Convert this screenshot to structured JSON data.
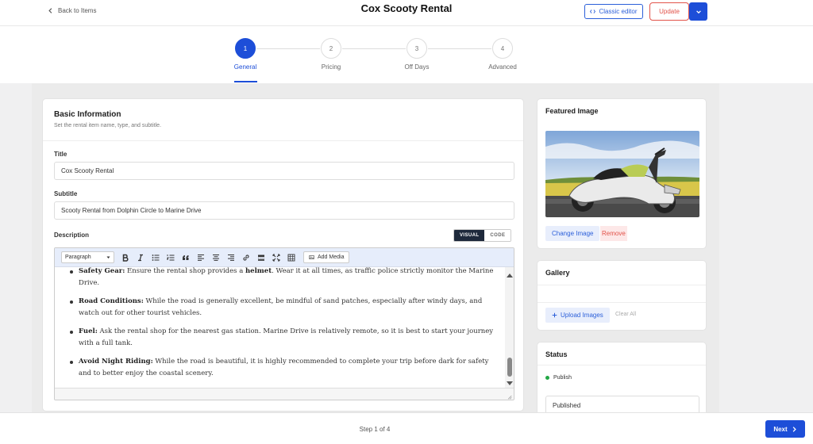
{
  "header": {
    "back_label": "Back to Items",
    "title": "Cox Scooty Rental",
    "classic_editor_label": "Classic editor",
    "update_label": "Update"
  },
  "stepper": {
    "steps": [
      {
        "number": "1",
        "label": "General",
        "active": true
      },
      {
        "number": "2",
        "label": "Pricing",
        "active": false
      },
      {
        "number": "3",
        "label": "Off Days",
        "active": false
      },
      {
        "number": "4",
        "label": "Advanced",
        "active": false
      }
    ]
  },
  "basic_info": {
    "title": "Basic Information",
    "subtitle": "Set the rental item name, type, and subtitle.",
    "title_label": "Title",
    "title_value": "Cox Scooty Rental",
    "subtitle_label": "Subtitle",
    "subtitle_value": "Scooty Rental from Dolphin Circle to Marine Drive",
    "description_label": "Description",
    "mode_visual": "VISUAL",
    "mode_code": "CODE",
    "paragraph_select": "Paragraph",
    "add_media_label": "Add Media",
    "list_items": [
      {
        "bold": "Safety Gear:",
        "text": " Ensure the rental shop provides a ",
        "bold2": "helmet",
        "text2": ". Wear it at all times, as traffic police strictly monitor the Marine Drive."
      },
      {
        "bold": "Road Conditions:",
        "text": " While the road is generally excellent, be mindful of sand patches, especially after windy days, and watch out for other tourist vehicles.",
        "bold2": "",
        "text2": ""
      },
      {
        "bold": "Fuel:",
        "text": " Ask the rental shop for the nearest gas station. Marine Drive is relatively remote, so it is best to start your journey with a full tank.",
        "bold2": "",
        "text2": ""
      },
      {
        "bold": "Avoid Night Riding:",
        "text": " While the road is beautiful, it is highly recommended to complete your trip before dark for safety and to better enjoy the coastal scenery.",
        "bold2": "",
        "text2": ""
      }
    ]
  },
  "featured_image": {
    "title": "Featured Image",
    "change_label": "Change Image",
    "remove_label": "Remove"
  },
  "gallery": {
    "title": "Gallery",
    "upload_label": "Upload Images",
    "clear_label": "Clear All"
  },
  "status": {
    "title": "Status",
    "publish_label": "Publish",
    "status_value": "Published",
    "publish_dot_color": "#22a745"
  },
  "footer": {
    "step_count": "Step 1 of 4",
    "next_label": "Next"
  },
  "colors": {
    "accent": "#1d4ed8",
    "danger": "#e2534a"
  }
}
